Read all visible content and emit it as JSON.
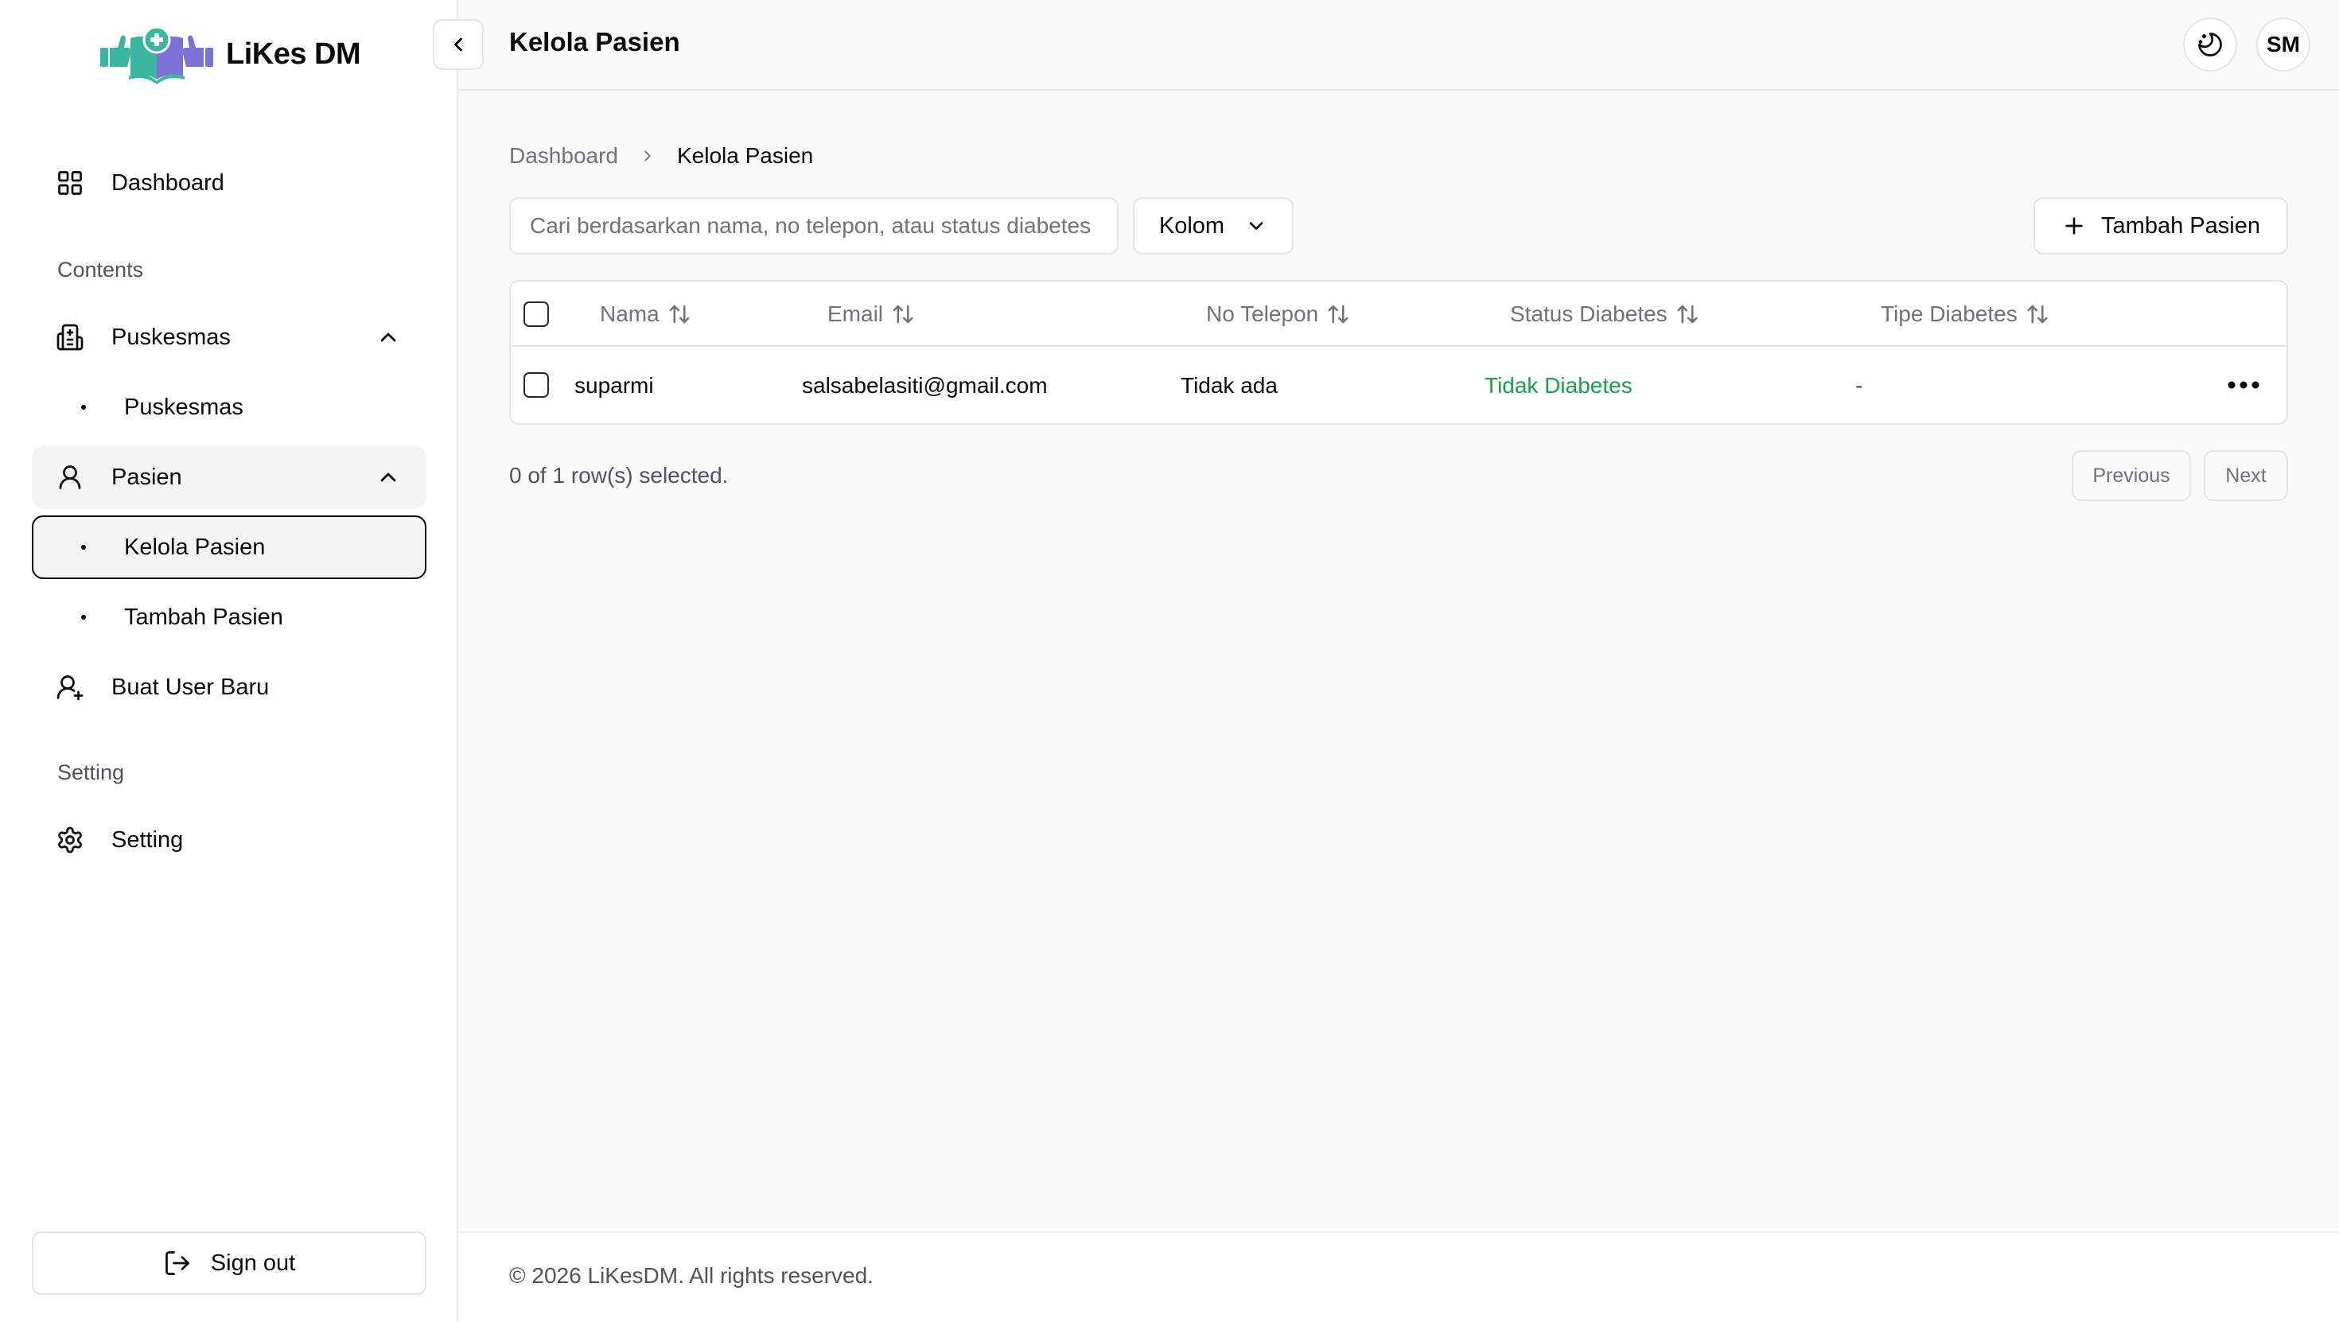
{
  "app": {
    "name": "LiKes DM",
    "colors": {
      "brand_teal": "#3bb6a3",
      "brand_purple": "#7b72d6",
      "status_green": "#16a34a"
    }
  },
  "sidebar": {
    "dashboard": {
      "label": "Dashboard",
      "icon": "layout-grid-icon"
    },
    "section_contents": "Contents",
    "puskesmas": {
      "label": "Puskesmas",
      "icon": "hospital-icon",
      "expanded": true,
      "children": [
        {
          "label": "Puskesmas"
        }
      ]
    },
    "pasien": {
      "label": "Pasien",
      "icon": "user-icon",
      "expanded": true,
      "children": [
        {
          "label": "Kelola Pasien",
          "selected": true
        },
        {
          "label": "Tambah Pasien"
        }
      ]
    },
    "buat_user": {
      "label": "Buat User Baru",
      "icon": "user-plus-icon"
    },
    "section_setting": "Setting",
    "setting": {
      "label": "Setting",
      "icon": "gear-icon"
    },
    "signout_label": "Sign out"
  },
  "header": {
    "title": "Kelola Pasien",
    "avatar_initials": "SM"
  },
  "breadcrumb": {
    "items": [
      "Dashboard",
      "Kelola Pasien"
    ]
  },
  "toolbar": {
    "search_placeholder": "Cari berdasarkan nama, no telepon, atau status diabetes",
    "columns_label": "Kolom",
    "add_label": "Tambah Pasien"
  },
  "table": {
    "columns": [
      "Nama",
      "Email",
      "No Telepon",
      "Status Diabetes",
      "Tipe Diabetes"
    ],
    "rows": [
      {
        "nama": "suparmi",
        "email": "salsabelasiti@gmail.com",
        "telepon": "Tidak ada",
        "status": "Tidak Diabetes",
        "tipe": "-"
      }
    ]
  },
  "pagination": {
    "selection_text": "0 of 1 row(s) selected.",
    "previous_label": "Previous",
    "next_label": "Next"
  },
  "footer": {
    "text": "© 2026 LiKesDM. All rights reserved."
  }
}
